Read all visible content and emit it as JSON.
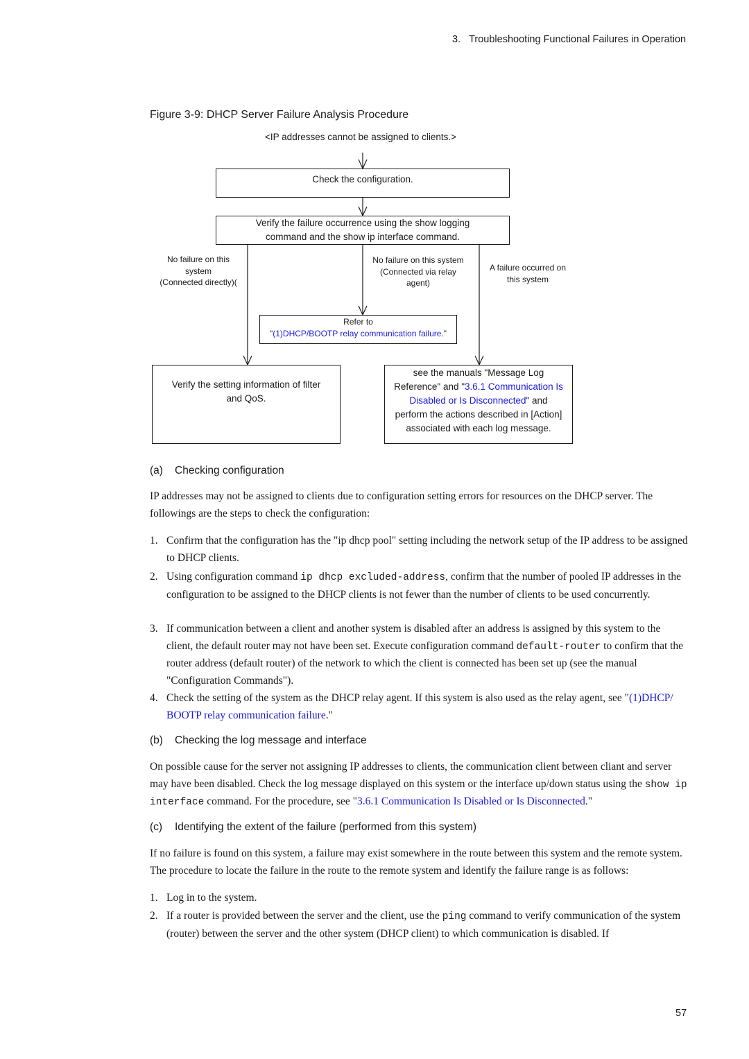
{
  "running_header": {
    "chapter_number": "3.",
    "chapter_title": "Troubleshooting Functional Failures in Operation"
  },
  "figure": {
    "caption": "Figure 3-9: DHCP Server Failure Analysis Procedure",
    "start_label": "<IP addresses cannot be assigned to clients.>",
    "box_check_config": "Check the configuration.",
    "box_verify_line1": "Verify the failure occurrence using the show logging",
    "box_verify_line2": "command and the show ip interface command.",
    "branch_left": [
      "No failure on this",
      "system",
      "(Connected directly)("
    ],
    "branch_middle": [
      "No failure on this system",
      "(Connected via relay",
      "agent)"
    ],
    "branch_right": [
      "A failure occurred on",
      "this system"
    ],
    "box_refer_line1": "Refer to",
    "box_refer_quote_open": "\"",
    "box_refer_link": "(1)DHCP/BOOTP relay communication failure",
    "box_refer_quote_close": ".\"",
    "box_filter_line1": "Verify the setting information of filter",
    "box_filter_line2": "and QoS.",
    "box_log_line1": "see the manuals \"Message Log",
    "box_log_line2_pre": "Reference\" and \"",
    "box_log_link_1": "3.6.1 Communication Is",
    "box_log_link_2": "Disabled or Is Disconnected",
    "box_log_line3_post": "\" and",
    "box_log_line4": "perform the actions described in [Action]",
    "box_log_line5": "associated with each log message."
  },
  "section_a": {
    "marker": "(a)",
    "title": "Checking configuration",
    "intro": "IP addresses may not be assigned to clients due to configuration setting errors for resources on the DHCP server. The followings are the steps to check the configuration:",
    "items": [
      {
        "n": "1.",
        "text": "Confirm that the configuration has the \"ip dhcp pool\" setting including the network setup of the IP address to be assigned to DHCP clients."
      },
      {
        "n": "2.",
        "pre": "Using configuration command ",
        "code": "ip dhcp excluded-address",
        "post": ", confirm that the number of pooled IP addresses in the configuration to be assigned to the DHCP clients is not fewer than the number of clients to be used concurrently."
      },
      {
        "n": "3.",
        "pre": "If communication between a client and another system is disabled after an address is assigned by this system to the client, the default router may not have been set. Execute configuration command ",
        "code": "default-router",
        "post": " to confirm that the router address (default router) of the network to which the client is connected has been set up (see the manual \"Configuration Commands\")."
      },
      {
        "n": "4.",
        "pre": "Check the setting of the system as the DHCP relay agent. If this system is also used as the relay agent, see \"",
        "link": "(1)DHCP/ BOOTP relay communication failure",
        "post": ".\""
      }
    ]
  },
  "section_b": {
    "marker": "(b)",
    "title": "Checking the log message and interface",
    "para_pre": "On possible cause for the server not assigning IP addresses to clients, the communication client between cliant and server may have been disabled. Check the log message displayed on this system or the interface up/down status using the ",
    "para_code": "show ip interface",
    "para_mid": " command. For the procedure, see \"",
    "para_link": "3.6.1 Communication Is Disabled or Is Disconnected",
    "para_post": ".\""
  },
  "section_c": {
    "marker": "(c)",
    "title": "Identifying the extent of the failure (performed from this system)",
    "intro": "If no failure is found on this system, a failure may exist somewhere in the route between this system and the remote system. The procedure to locate the failure in the route to the remote system and identify the failure range is as follows:",
    "items": [
      {
        "n": "1.",
        "text": "Log in to the system."
      },
      {
        "n": "2.",
        "pre": "If a router is provided between the server and the client, use the ",
        "code": "ping",
        "post": " command to verify communication of the system (router) between the server and the other system (DHCP client) to which communication is disabled. If"
      }
    ]
  },
  "page_number": "57",
  "colors": {
    "link": "#1a1adc",
    "text": "#1a1a1a"
  }
}
